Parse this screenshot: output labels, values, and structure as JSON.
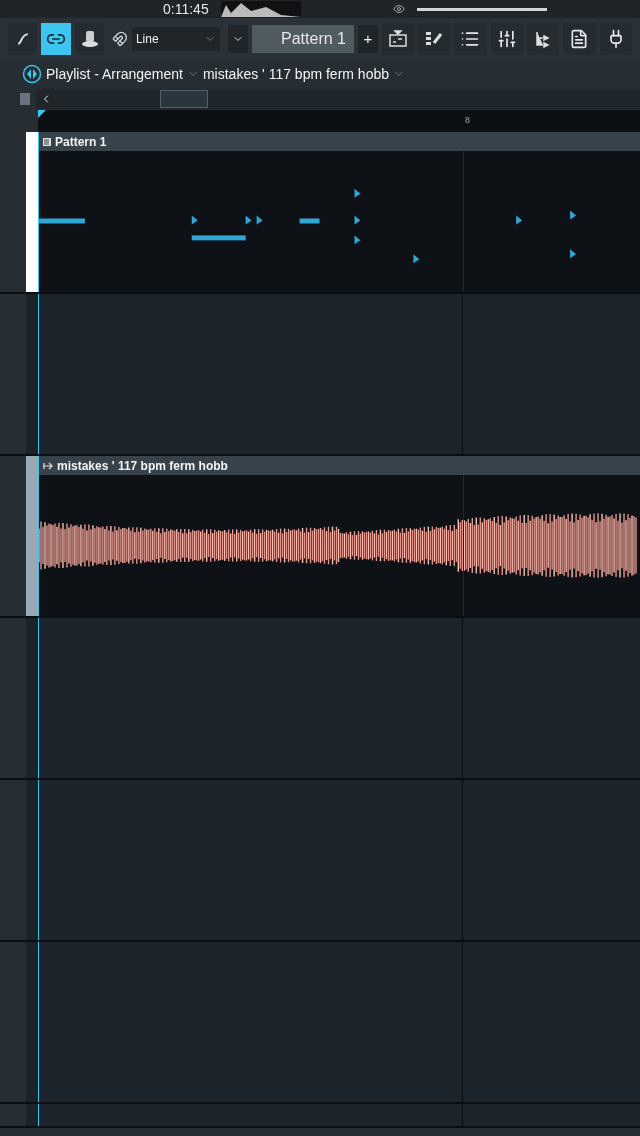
{
  "transport": {
    "time": "0:11:45"
  },
  "toolbar": {
    "left_buttons": [
      {
        "selected": false
      },
      {
        "selected": true
      },
      {
        "selected": false
      }
    ],
    "snap": {
      "value": "Line"
    },
    "pattern": {
      "value": "Pattern 1"
    },
    "add_button": "+",
    "right_buttons": [
      {
        "selected": false
      },
      {
        "selected": false
      },
      {
        "selected": false
      },
      {
        "selected": false
      },
      {
        "selected": false
      },
      {
        "selected": false
      },
      {
        "selected": false
      }
    ]
  },
  "playlist": {
    "title": "Playlist - Arrangement",
    "song": "mistakes ' 117 bpm ferm hobb"
  },
  "timeline": {
    "markers": [
      "8"
    ]
  },
  "tracks": [
    {
      "kind": "clip",
      "clip": {
        "kind": "pattern",
        "name": "Pattern 1"
      }
    },
    {
      "kind": "empty"
    },
    {
      "kind": "clip",
      "clip": {
        "kind": "audio",
        "name": "mistakes ' 117 bpm ferm hobb"
      }
    },
    {
      "kind": "empty"
    },
    {
      "kind": "empty"
    },
    {
      "kind": "empty"
    },
    {
      "kind": "empty"
    }
  ]
}
